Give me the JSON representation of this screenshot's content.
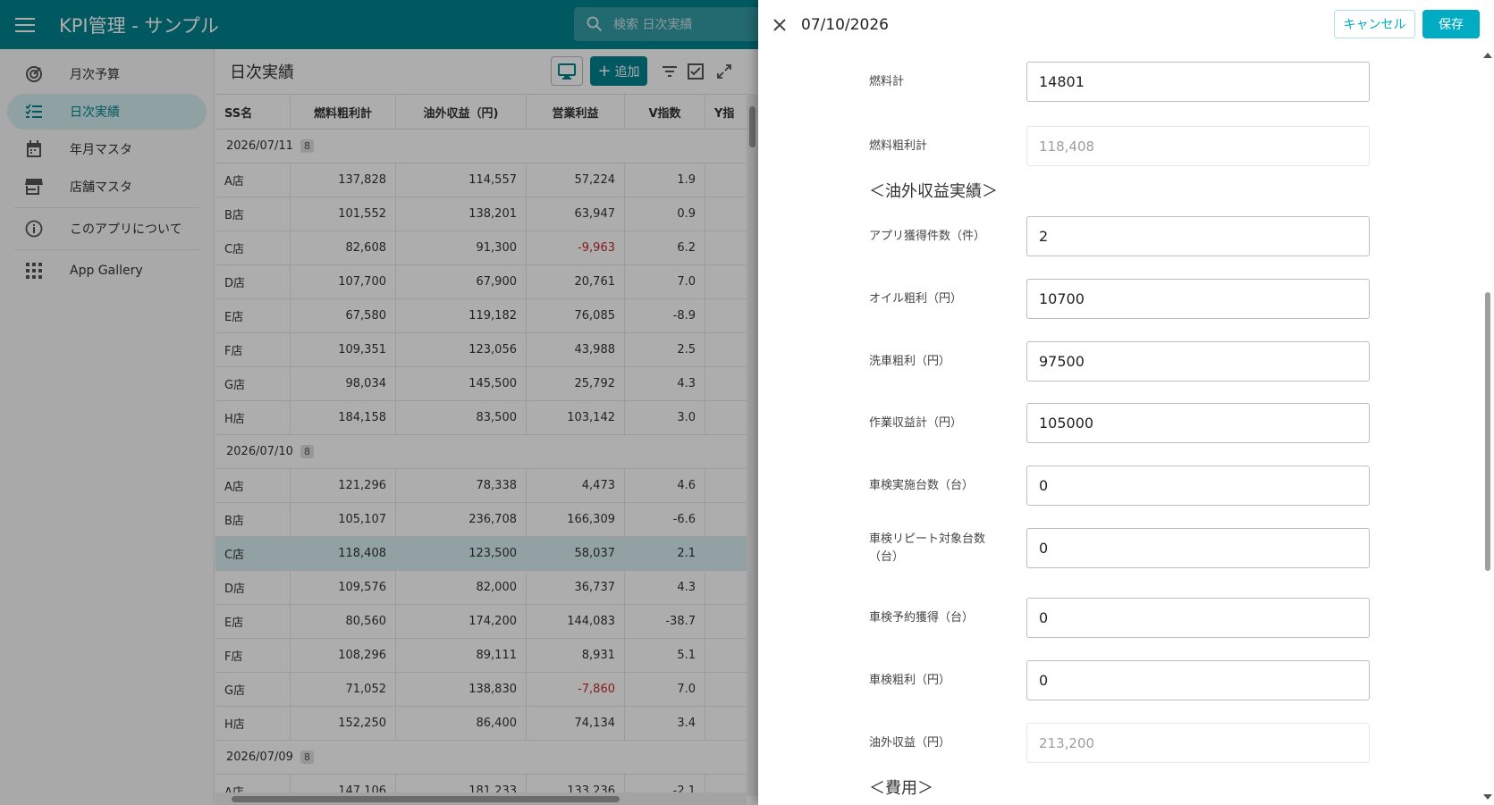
{
  "app": {
    "title": "KPI管理 - サンプル",
    "search_placeholder": "検索 日次実績"
  },
  "sidebar": {
    "items": [
      {
        "label": "月次予算",
        "icon": "target-icon"
      },
      {
        "label": "日次実績",
        "icon": "checklist-icon",
        "active": true
      },
      {
        "label": "年月マスタ",
        "icon": "calendar-icon"
      },
      {
        "label": "店舗マスタ",
        "icon": "store-icon"
      },
      {
        "label": "このアプリについて",
        "icon": "info-icon"
      },
      {
        "label": "App Gallery",
        "icon": "apps-grid-icon"
      }
    ]
  },
  "view": {
    "title": "日次実績",
    "add_label": "追加",
    "columns": [
      "SS名",
      "燃料粗利計",
      "油外収益（円)",
      "営業利益",
      "V指数",
      "Y指"
    ],
    "groups": [
      {
        "label": "2026/07/11",
        "count": "8",
        "rows": [
          [
            "A店",
            "137,828",
            "114,557",
            "57,224",
            "1.9"
          ],
          [
            "B店",
            "101,552",
            "138,201",
            "63,947",
            "0.9"
          ],
          [
            "C店",
            "82,608",
            "91,300",
            "-9,963",
            "6.2"
          ],
          [
            "D店",
            "107,700",
            "67,900",
            "20,761",
            "7.0"
          ],
          [
            "E店",
            "67,580",
            "119,182",
            "76,085",
            "-8.9"
          ],
          [
            "F店",
            "109,351",
            "123,056",
            "43,988",
            "2.5"
          ],
          [
            "G店",
            "98,034",
            "145,500",
            "25,792",
            "4.3"
          ],
          [
            "H店",
            "184,158",
            "83,500",
            "103,142",
            "3.0"
          ]
        ]
      },
      {
        "label": "2026/07/10",
        "count": "8",
        "rows": [
          [
            "A店",
            "121,296",
            "78,338",
            "4,473",
            "4.6"
          ],
          [
            "B店",
            "105,107",
            "236,708",
            "166,309",
            "-6.6"
          ],
          [
            "C店",
            "118,408",
            "123,500",
            "58,037",
            "2.1"
          ],
          [
            "D店",
            "109,576",
            "82,000",
            "36,737",
            "4.3"
          ],
          [
            "E店",
            "80,560",
            "174,200",
            "144,083",
            "-38.7"
          ],
          [
            "F店",
            "108,296",
            "89,111",
            "8,931",
            "5.1"
          ],
          [
            "G店",
            "71,052",
            "138,830",
            "-7,860",
            "7.0"
          ],
          [
            "H店",
            "152,250",
            "86,400",
            "74,134",
            "3.4"
          ]
        ]
      },
      {
        "label": "2026/07/09",
        "count": "8",
        "rows": [
          [
            "A店",
            "147,106",
            "181,233",
            "133,236",
            "-2.1"
          ]
        ]
      }
    ]
  },
  "drawer": {
    "date": "07/10/2026",
    "cancel_label": "キャンセル",
    "save_label": "保存",
    "fields": {
      "fuel_total": {
        "label": "燃料計",
        "value": "14801"
      },
      "fuel_gross_total": {
        "label": "燃料粗利計",
        "value": "118,408"
      },
      "section_nonfuel": "＜油外収益実績＞",
      "app_acquired": {
        "label": "アプリ獲得件数（件）",
        "value": "2"
      },
      "oil_gross": {
        "label": "オイル粗利（円）",
        "value": "10700"
      },
      "wash_gross": {
        "label": "洗車粗利（円）",
        "value": "97500"
      },
      "work_revenue": {
        "label": "作業収益計（円）",
        "value": "105000"
      },
      "inspection_count": {
        "label": "車検実施台数（台）",
        "value": "0"
      },
      "inspection_repeat": {
        "label": "車検リピート対象台数（台）",
        "value": "0"
      },
      "inspection_reserve": {
        "label": "車検予約獲得（台）",
        "value": "0"
      },
      "inspection_gross": {
        "label": "車検粗利（円）",
        "value": "0"
      },
      "nonfuel_revenue": {
        "label": "油外収益（円）",
        "value": "213,200"
      },
      "section_cost": "＜費用＞"
    }
  },
  "colors": {
    "appbar": "#00838f",
    "accent": "#00acc1",
    "negative": "#c62828"
  }
}
